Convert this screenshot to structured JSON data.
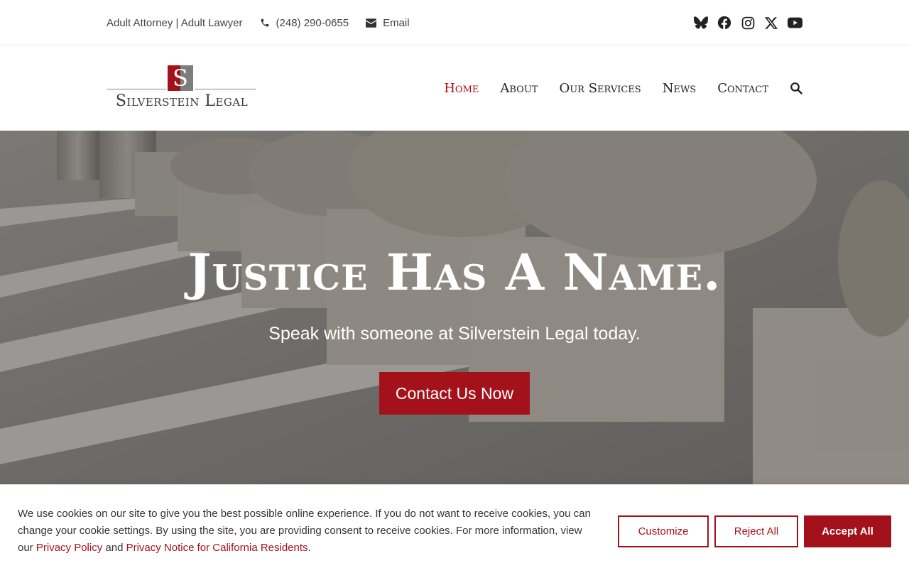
{
  "topbar": {
    "tagline": "Adult Attorney | Adult Lawyer",
    "phone": "(248) 290-0655",
    "email_label": "Email",
    "social_icons": [
      "bluesky-icon",
      "facebook-icon",
      "instagram-icon",
      "x-icon",
      "youtube-icon"
    ]
  },
  "header": {
    "logo_text": "Silverstein Legal",
    "nav": {
      "home": "Home",
      "about": "About",
      "services": "Our Services",
      "news": "News",
      "contact": "Contact"
    }
  },
  "hero": {
    "title": "Justice Has A Name.",
    "subtitle": "Speak with someone at Silverstein Legal today.",
    "cta": "Contact Us Now"
  },
  "cookie": {
    "text_before": "We use cookies on our site to give you the best possible online experience. If you do not want to receive cookies, you can change your cookie settings. By using the site, you are providing consent to receive cookies. For more information, view our ",
    "privacy_link": "Privacy Policy",
    "and": " and ",
    "california_link": "Privacy Notice for California Residents",
    "period": ".",
    "customize": "Customize",
    "reject": "Reject All",
    "accept": "Accept All"
  },
  "colors": {
    "brand_red": "#a3121b",
    "text_dark": "#222222"
  }
}
